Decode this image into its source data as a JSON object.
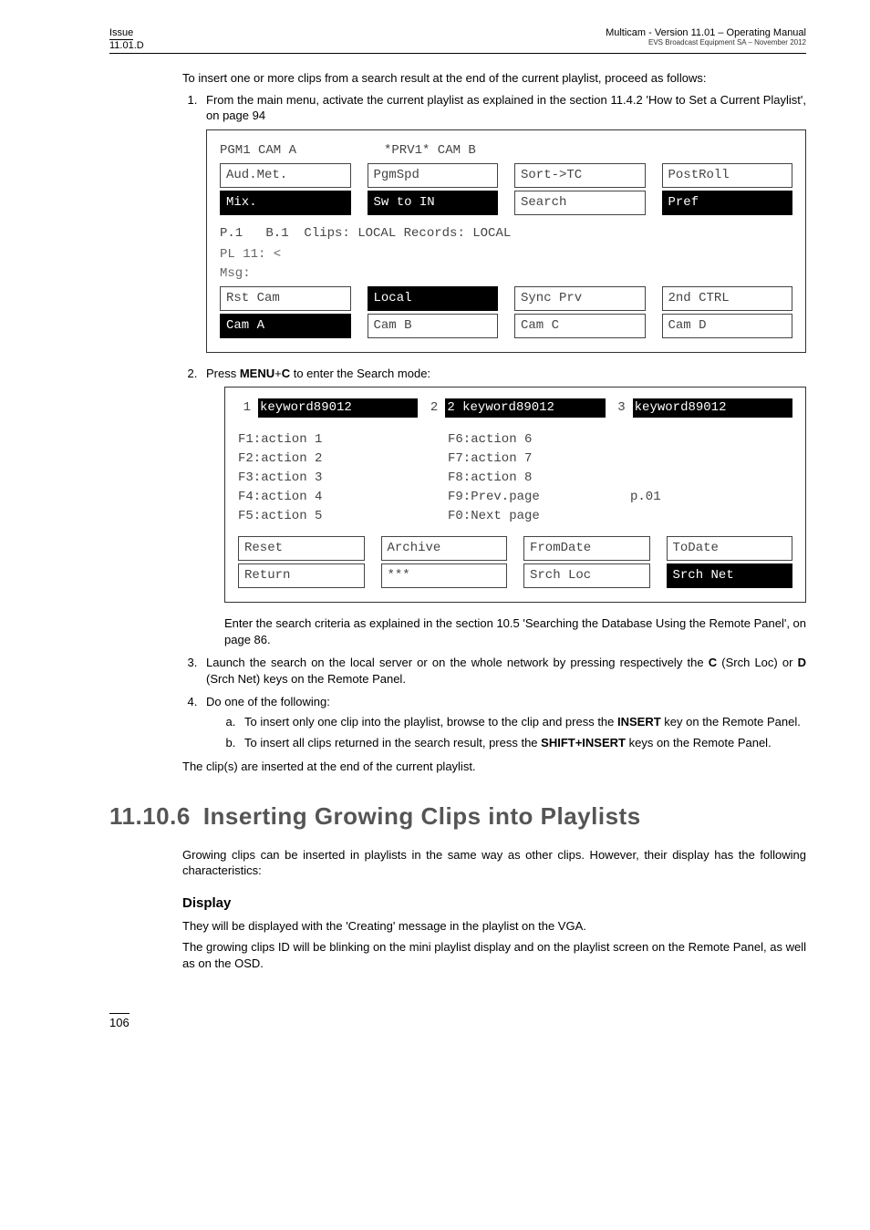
{
  "header": {
    "issue_label": "Issue",
    "issue_value": "11.01.D",
    "doc_title": "Multicam - Version 11.01 – Operating Manual",
    "doc_sub": "EVS Broadcast Equipment SA – November 2012"
  },
  "intro": "To insert one or more clips from a search result at the end of the current playlist, proceed as follows:",
  "step1": "From the main menu, activate the current playlist as explained in the section 11.4.2 'How to Set a Current Playlist', on page 94",
  "panel1": {
    "head_left": "PGM1 CAM A",
    "head_mid": "*PRV1* CAM B",
    "row1": {
      "a": "Aud.Met.",
      "b": "PgmSpd",
      "c": "Sort->TC",
      "d": "PostRoll"
    },
    "row2": {
      "a": "Mix.",
      "b": "Sw to IN",
      "c": "Search",
      "d": "Pref"
    },
    "clips_line": "P.1   B.1  Clips: LOCAL Records: LOCAL",
    "pl_line": "PL 11: <",
    "msg_line": "Msg:",
    "row3": {
      "a": "Rst Cam",
      "b": "Local",
      "c": "Sync Prv",
      "d": "2nd CTRL"
    },
    "row4": {
      "a": "Cam A",
      "b": "Cam B",
      "c": "Cam C",
      "d": "Cam D"
    }
  },
  "step2_pre": "Press ",
  "step2_bold": "MENU",
  "step2_plus": "+",
  "step2_bold2": "C",
  "step2_post": "  to enter the Search mode:",
  "panel2": {
    "kw_fill": "keyword89012",
    "kw_midprefix": "2",
    "kw_mid": "2 keyword89012",
    "actions_left": [
      "F1:action 1",
      "F2:action 2",
      "F3:action 3",
      "F4:action 4",
      "F5:action 5"
    ],
    "actions_right": [
      "F6:action 6",
      "F7:action 7",
      "F8:action 8",
      "F9:Prev.page",
      "F0:Next page"
    ],
    "page_lbl": "p.01",
    "row1": {
      "a": "Reset",
      "b": "Archive",
      "c": "FromDate",
      "d": "ToDate"
    },
    "row2": {
      "a": "Return",
      "b": "***",
      "c": "Srch Loc",
      "d": "Srch Net"
    }
  },
  "after_panel2": "Enter the search criteria as explained in the section 10.5 'Searching the Database Using the Remote Panel', on page 86.",
  "step3_a": "Launch the search on the local server or on the whole network by pressing respectively the ",
  "step3_b": " (Srch Loc) or ",
  "step3_c": " (Srch Net) keys on the Remote Panel.",
  "step3_C": "C",
  "step3_D": "D",
  "step4": "Do one of the following:",
  "step4a_a": "To insert only one clip into the playlist, browse to the clip and press the ",
  "step4a_key": "INSERT",
  "step4a_b": " key on the Remote Panel.",
  "step4b_a": "To insert all clips returned in the search result, press the ",
  "step4b_key": "SHIFT+INSERT",
  "step4b_b": " keys on the Remote Panel.",
  "conclude": "The clip(s) are inserted at the end of the current playlist.",
  "section": {
    "num": "11.10.6",
    "title": "Inserting Growing Clips into Playlists"
  },
  "section_para": "Growing clips can be inserted in playlists in the same way as other clips. However, their display has the following characteristics:",
  "display_head": "Display",
  "display_p1": "They will be displayed with the 'Creating' message in the playlist on the VGA.",
  "display_p2": "The growing clips ID will be blinking on the mini playlist display and on the playlist screen on the Remote Panel, as well as on the OSD.",
  "page_number": "106"
}
